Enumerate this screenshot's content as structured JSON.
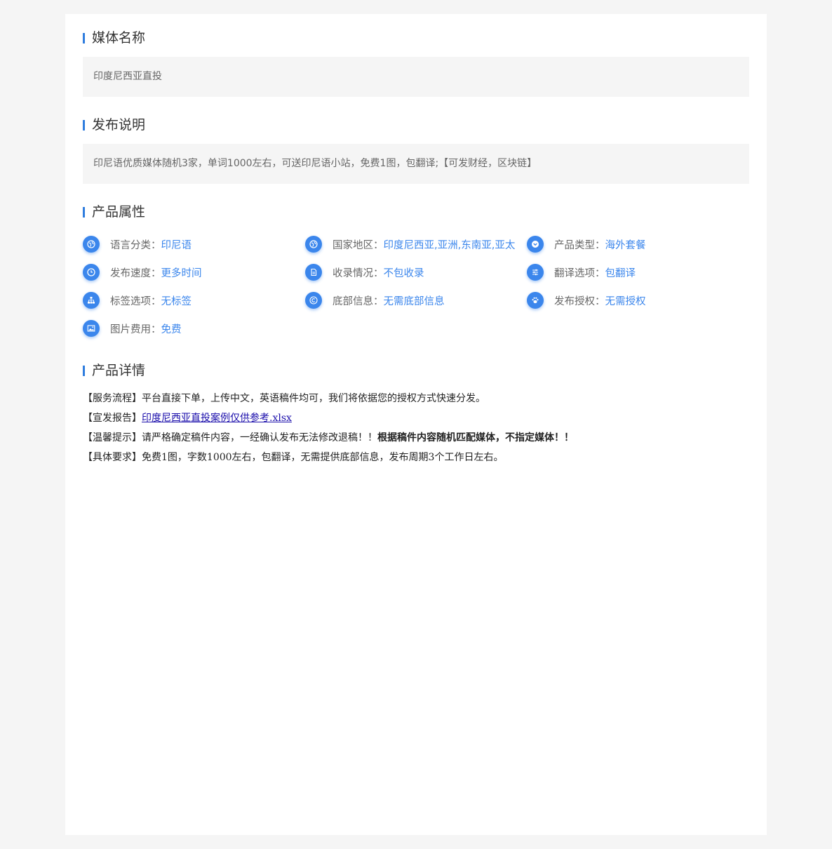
{
  "sections": {
    "media_name": {
      "title": "媒体名称",
      "value": "印度尼西亚直投"
    },
    "publish_desc": {
      "title": "发布说明",
      "value": "印尼语优质媒体随机3家，单词1000左右，可送印尼语小站，免费1图，包翻译;【可发财经，区块链】"
    },
    "attributes": {
      "title": "产品属性",
      "items": [
        {
          "icon": "globe-icon",
          "label": "语言分类：",
          "value": "印尼语"
        },
        {
          "icon": "globe-icon",
          "label": "国家地区：",
          "value": "印度尼西亚,亚洲,东南亚,亚太"
        },
        {
          "icon": "chevron-down-icon",
          "label": "产品类型：",
          "value": "海外套餐"
        },
        {
          "icon": "clock-icon",
          "label": "发布速度：",
          "value": "更多时间"
        },
        {
          "icon": "document-icon",
          "label": "收录情况：",
          "value": "不包收录"
        },
        {
          "icon": "sliders-icon",
          "label": "翻译选项：",
          "value": "包翻译"
        },
        {
          "icon": "sitemap-icon",
          "label": "标签选项：",
          "value": "无标签"
        },
        {
          "icon": "copyright-icon",
          "label": "底部信息：",
          "value": "无需底部信息"
        },
        {
          "icon": "paw-icon",
          "label": "发布授权：",
          "value": "无需授权"
        },
        {
          "icon": "image-icon",
          "label": "图片费用：",
          "value": "免费"
        }
      ]
    },
    "details": {
      "title": "产品详情",
      "lines": {
        "service": {
          "prefix": "【服务流程】",
          "text": "平台直接下单，上传中文，英语稿件均可，我们将依据您的授权方式快速分发。"
        },
        "report": {
          "prefix": "【宣发报告】",
          "link": "印度尼西亚直投案例仅供参考.xlsx"
        },
        "tip": {
          "prefix": "【温馨提示】",
          "text": "请严格确定稿件内容，一经确认发布无法修改退稿！！",
          "bold": "根据稿件内容随机匹配媒体，不指定媒体！！"
        },
        "requirement": {
          "prefix": "【具体要求】",
          "text": "免费1图，字数1000左右，包翻译，无需提供底部信息，发布周期3个工作日左右。"
        }
      }
    }
  },
  "colors": {
    "accent": "#3b86ec",
    "page_bg": "#f5f5f5",
    "box_bg": "#f5f5f5",
    "link": "#1a0dab"
  }
}
